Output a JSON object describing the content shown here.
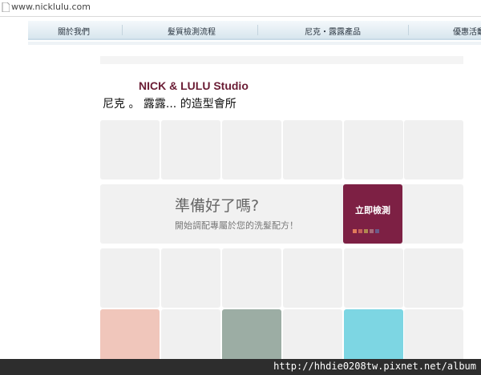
{
  "browser": {
    "url": "www.nicklulu.com"
  },
  "nav": {
    "items": [
      {
        "label": "關於我們"
      },
      {
        "label": "髮質檢測流程"
      },
      {
        "label": "尼克・露露產品"
      },
      {
        "label": "優惠活動"
      }
    ]
  },
  "studio": {
    "title": "NICK & LULU Studio",
    "subtitle": "尼克 。 露露... 的造型會所"
  },
  "banner": {
    "title": "準備好了嗎?",
    "subtitle": "開始調配專屬於您的洗髮配方！",
    "cta_label": "立即檢測"
  },
  "colors": {
    "cta": "#7d2044",
    "tile": "#f0f0f0",
    "swatch_pink": "#f0c6bb",
    "swatch_sage": "#9cada4",
    "swatch_cyan": "#7dd6e3",
    "cta_dots": [
      "#e07a5a",
      "#c6605a",
      "#b08850",
      "#a86a7a",
      "#6a5a8a"
    ]
  },
  "watermark": "http://hhdie0208tw.pixnet.net/album"
}
